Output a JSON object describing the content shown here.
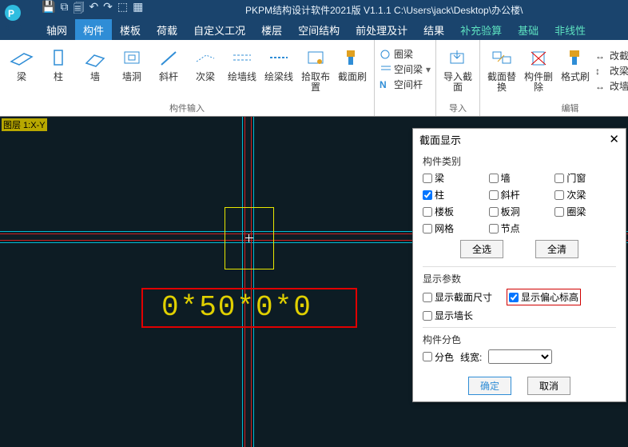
{
  "title": "PKPM结构设计软件2021版 V1.1.1 C:\\Users\\jack\\Desktop\\办公楼\\",
  "menu": {
    "tabs": [
      "轴网",
      "构件",
      "楼板",
      "荷载",
      "自定义工况",
      "楼层",
      "空间结构",
      "前处理及计",
      "结果"
    ],
    "active": 1,
    "extra_green": [
      "补充验算",
      "基础"
    ],
    "extra_org": "非线性"
  },
  "ribbon": {
    "group1": {
      "label": "构件输入",
      "buttons": [
        "梁",
        "柱",
        "墙",
        "墙洞",
        "斜杆",
        "次梁",
        "绘墙线",
        "绘梁线",
        "拾取布置",
        "截面刷"
      ]
    },
    "side": {
      "r1": {
        "ico": "ring",
        "label": "圈梁"
      },
      "r2": {
        "ico": "grid",
        "label": "空间梁"
      },
      "r3": {
        "ico": "N",
        "label": "空间杆"
      }
    },
    "group2": {
      "label": "导入",
      "b1": "导入截面"
    },
    "group3": {
      "b1": "截面替换",
      "b2": "构件删除",
      "b3": "格式刷",
      "r1": "改截宽",
      "r2": "改梁高",
      "r3": "改墙宽",
      "label": "编辑"
    }
  },
  "canvas": {
    "corner": "图层 1:X-Y",
    "dim": "0*50*0*0"
  },
  "dialog": {
    "title": "截面显示",
    "sec1": "构件类别",
    "ck": {
      "beam": "梁",
      "wall": "墙",
      "door": "门窗",
      "col": "柱",
      "brace": "斜杆",
      "secbeam": "次梁",
      "slab": "楼板",
      "slabhole": "板洞",
      "ring": "圈梁",
      "grid": "网格",
      "node": "节点"
    },
    "col_checked": true,
    "btn_all": "全选",
    "btn_none": "全清",
    "sec2": "显示参数",
    "p1": "显示截面尺寸",
    "p2": "显示偏心标高",
    "p2_checked": true,
    "p3": "显示墙长",
    "sec3": "构件分色",
    "p4": "分色",
    "lw": "线宽:",
    "lw_val": "",
    "ok": "确定",
    "cancel": "取消"
  }
}
